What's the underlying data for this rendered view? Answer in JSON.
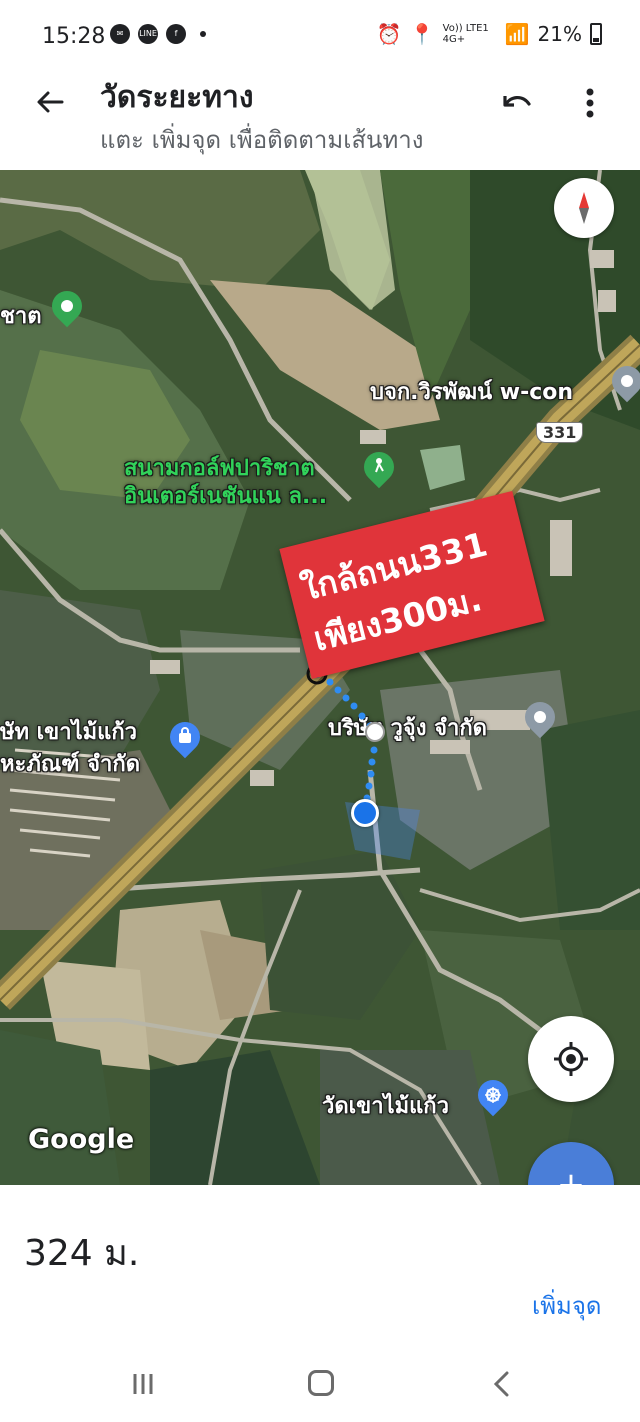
{
  "status": {
    "time": "15:28",
    "app_icons": [
      "messenger-icon",
      "line-icon",
      "facebook-icon"
    ],
    "network": "Vo)) LTE1 4G+",
    "battery": "21%"
  },
  "appbar": {
    "title": "วัดระยะทาง",
    "subtitle": "แตะ เพิ่มจุด เพื่อติดตามเส้นทาง"
  },
  "map": {
    "places": {
      "left_edge": "ชาต",
      "wcon": "บจก.วิรพัฒน์ w-con",
      "golf_line1": "สนามกอล์ฟปาริชาต",
      "golf_line2": "อินเตอร์เนชันแน ล...",
      "shop_line1": "ษัท เขาไม้แก้ว",
      "shop_line2": "หะภัณฑ์ จำกัด",
      "company": "บริษัท วูจุ้ง จำกัด",
      "temple": "วัดเขาไม้แก้ว"
    },
    "road_shield": "331",
    "banner": {
      "line1": "ใกล้ถนน331",
      "line2": "เพียง300ม."
    },
    "google_logo": "Google"
  },
  "bottom": {
    "distance": "324 ม.",
    "add_point": "เพิ่มจุด"
  },
  "colors": {
    "accent_blue": "#1a73e8",
    "fab_blue": "#4a7ed8",
    "banner_red": "#e0343a",
    "pin_green": "#34a853",
    "route_dot": "#2f8cf2"
  }
}
